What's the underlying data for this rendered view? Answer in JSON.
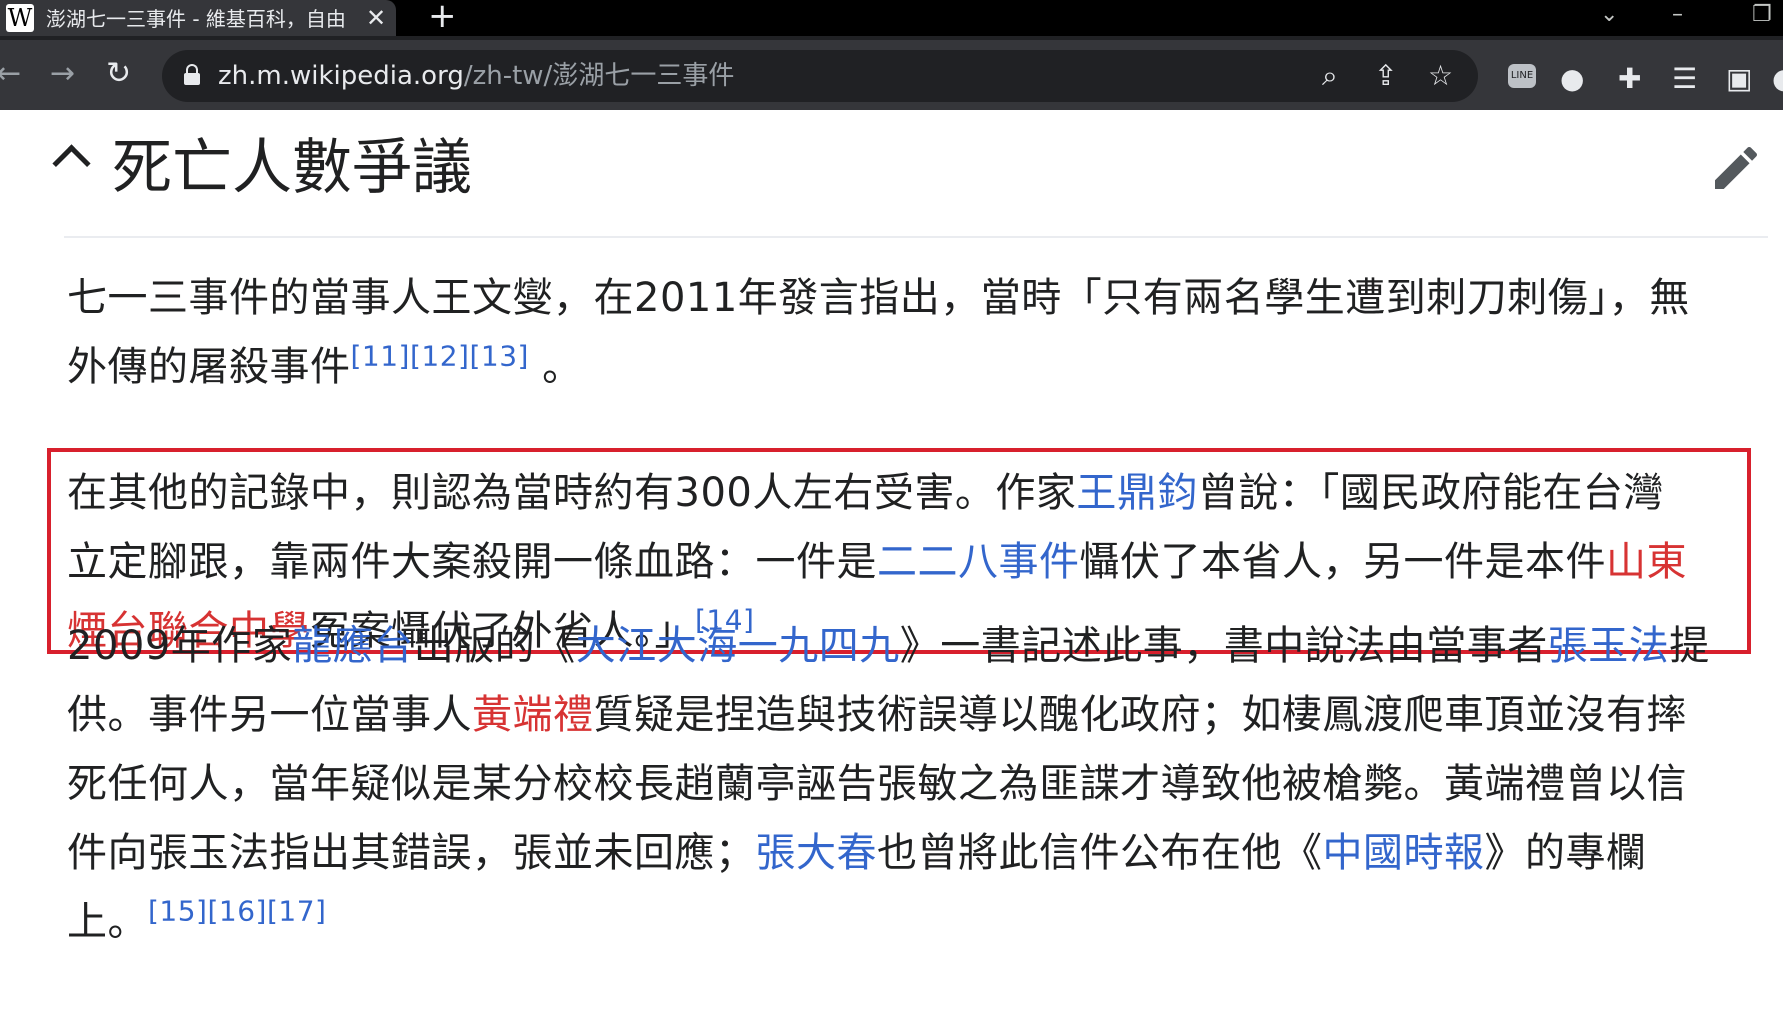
{
  "browser": {
    "tab_title": "澎湖七一三事件 - 維基百科，自由",
    "favicon": "W",
    "url_domain": "zh.m.wikipedia.org",
    "url_path": "/zh-tw/澎湖七一三事件"
  },
  "section": {
    "title": "死亡人數爭議"
  },
  "paragraph1": {
    "l1": "七一三事件的當事人王文燮，在2011年發言指出，當時「只有兩名學生遭到刺刀刺傷」，無",
    "l2_text": "外傳的屠殺事件",
    "refs": [
      "[11]",
      "[12]",
      "[13]"
    ],
    "end": "。"
  },
  "paragraph2": {
    "l1_a": "在其他的記錄中，則認為當時約有300人左右受害。作家",
    "link_wang": "王鼎鈞",
    "l1_b": "曾說：「國民政府能在台灣",
    "l2_a": "立定腳跟，靠兩件大案殺開一條血路：一件是",
    "link_228": "二二八事件",
    "l2_b": "懾伏了本省人，另一件是本件",
    "link_school_1": "山東",
    "link_school_2": "煙台聯合中學",
    "l3_b": "冤案懾伏了外省人。」",
    "ref": "[14]"
  },
  "paragraph3": {
    "l1_a": "2009年作家",
    "link_long": "龍應台",
    "l1_b": "出版的《",
    "link_book": "大江大海一九四九",
    "l1_c": "》一書記述此事，書中說法由當事者",
    "link_zhang": "張玉法",
    "l1_d": "提",
    "l2_a": "供。事件另一位當事人",
    "link_huang": "黃端禮",
    "l2_b": "質疑是捏造與技術誤導以醜化政府；如棲鳳渡爬車頂並沒有摔",
    "l3": "死任何人，當年疑似是某分校校長趙蘭亭誣告張敏之為匪諜才導致他被槍斃。黃端禮曾以信",
    "l4_a": "件向張玉法指出其錯誤，張並未回應；",
    "link_zdc": "張大春",
    "l4_b": "也曾將此信件公布在他《",
    "link_paper": "中國時報",
    "l4_c": "》的專欄",
    "l5_a": "上。",
    "refs": [
      "[15]",
      "[16]",
      "[17]"
    ]
  },
  "colors": {
    "link": "#3366cc",
    "redlink": "#d73333",
    "highlight": "#d8202d"
  }
}
